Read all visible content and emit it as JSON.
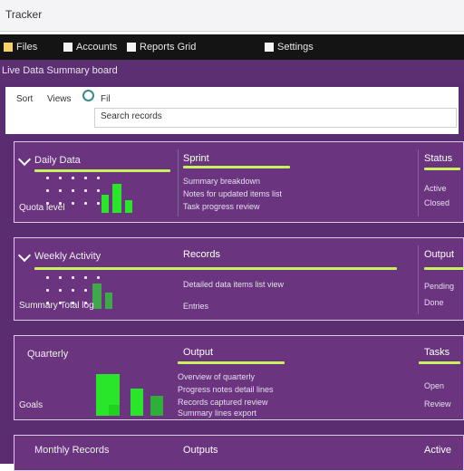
{
  "window": {
    "title": "Tracker"
  },
  "toolbar": {
    "items": [
      {
        "label": "Files",
        "color": "#f5d06b"
      },
      {
        "label": "Accounts",
        "color": "#f3f3f3"
      },
      {
        "label": "Reports Grid",
        "color": "#f3f3f3"
      },
      {
        "label": "Settings",
        "color": "#f3f3f3"
      }
    ]
  },
  "subbar": {
    "text": "Live Data Summary board"
  },
  "search": {
    "label_a": "Sort",
    "label_b": "Views",
    "label_c": "Fil",
    "input_value": "Search records"
  },
  "cards": [
    {
      "title": "Daily Data",
      "footer": "Quota level",
      "mid_title": "Sprint",
      "mid_lines": [
        "Summary breakdown",
        "Notes for updated items list",
        "Task progress review"
      ],
      "right_title": "Status",
      "right_lines": [
        "Active",
        "Closed"
      ]
    },
    {
      "title": "Weekly Activity",
      "footer": "Summary Total log",
      "mid_title": "Records",
      "mid_lines": [
        "Detailed data items list view",
        "Entries"
      ],
      "right_title": "Output",
      "right_lines": [
        "Pending",
        "Done"
      ]
    },
    {
      "title": "Quarterly",
      "footer": "Goals",
      "mid_title": "Output",
      "mid_lines": [
        "Overview of quarterly",
        "Progress notes detail lines",
        "Records captured review",
        "Summary lines export"
      ],
      "right_title": "Tasks",
      "right_lines": [
        "Open",
        "Review"
      ]
    },
    {
      "title": "Monthly Records",
      "mid_title": "Outputs",
      "right_title": "Active"
    }
  ],
  "colors": {
    "accent_green": "#29e62b",
    "lime_line": "#c8f25b",
    "purple_bg": "#5a2d70"
  }
}
